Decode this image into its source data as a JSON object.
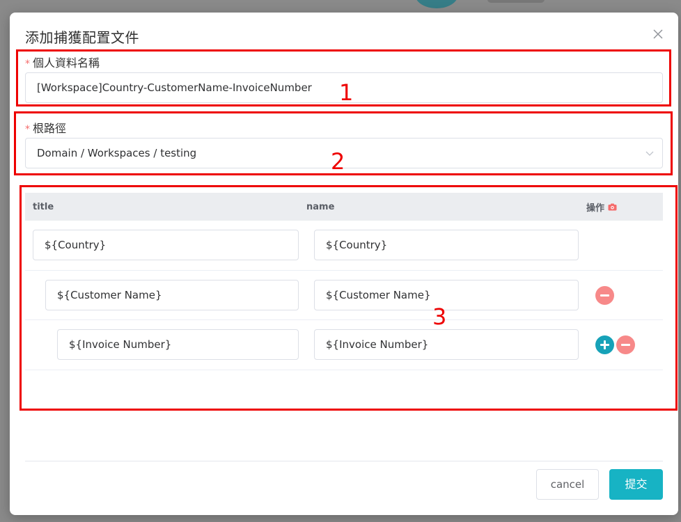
{
  "dialog": {
    "title": "添加捕獲配置文件"
  },
  "form": {
    "profile_name": {
      "required_mark": "*",
      "label": "個人資料名稱",
      "value": "[Workspace]Country-CustomerName-InvoiceNumber"
    },
    "root_path": {
      "required_mark": "*",
      "label": "根路徑",
      "value": "Domain / Workspaces / testing"
    }
  },
  "table": {
    "headers": {
      "title": "title",
      "name": "name",
      "operations": "操作"
    },
    "rows": [
      {
        "title": "${Country}",
        "name": "${Country}"
      },
      {
        "title": "${Customer Name}",
        "name": "${Customer Name}"
      },
      {
        "title": "${Invoice Number}",
        "name": "${Invoice Number}"
      }
    ]
  },
  "footer": {
    "cancel_label": "cancel",
    "submit_label": "提交"
  },
  "annotations": [
    "1",
    "2",
    "3"
  ],
  "colors": {
    "accent": "#17b3c4",
    "plus": "#17a2b8",
    "minus": "#f78989",
    "required": "#f56c6c",
    "annotation": "#ee0000"
  },
  "icons": {
    "close": "close-icon",
    "dropdown": "chevron-down-icon",
    "ops_header": "camera-icon",
    "add": "plus-circle-icon",
    "remove": "minus-circle-icon"
  }
}
